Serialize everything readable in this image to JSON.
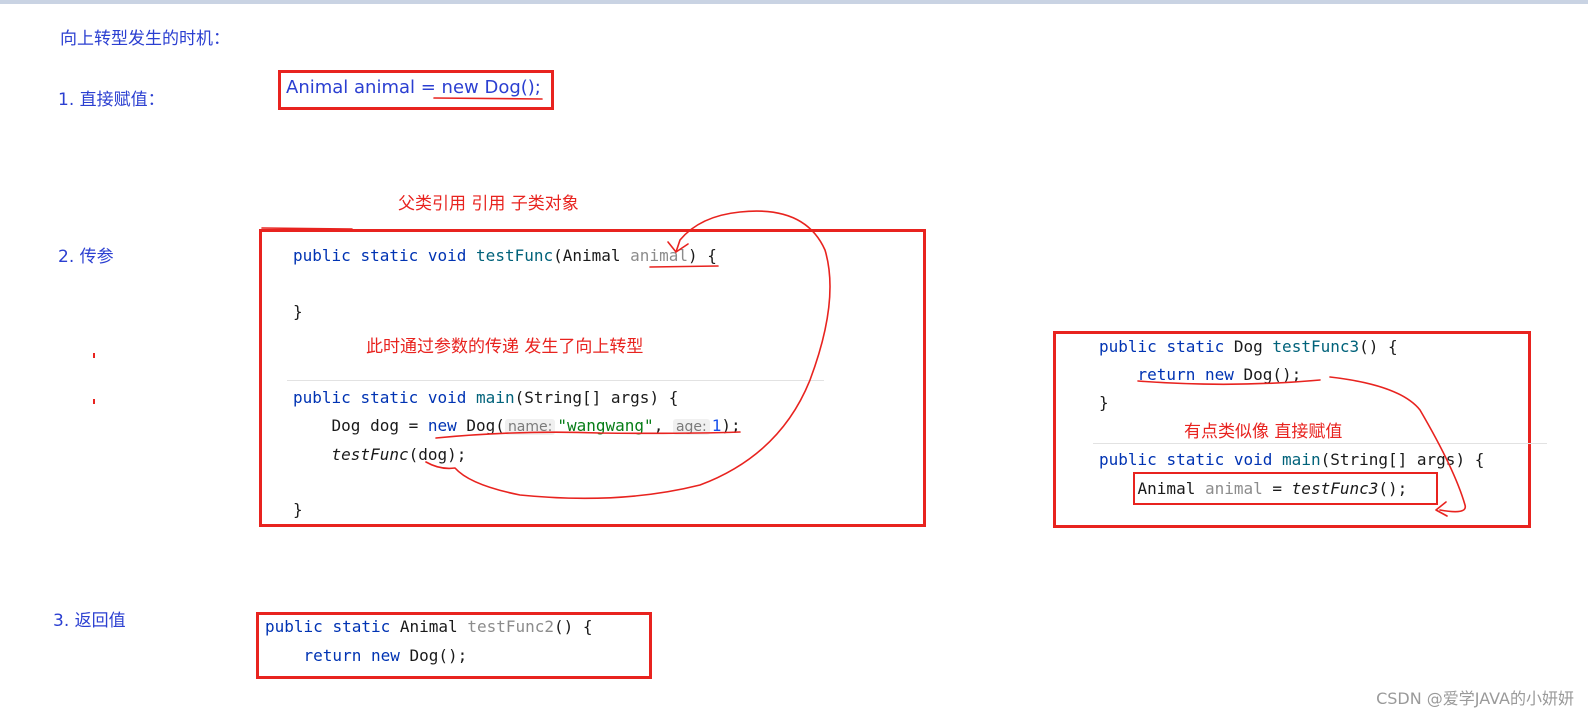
{
  "heading": "向上转型发生的时机：",
  "sections": {
    "s1": {
      "label": "1. 直接赋值：",
      "code": "Animal animal = new Dog();"
    },
    "s2": {
      "label": "2. 传参",
      "annotation_top": "父类引用  引用 子类对象",
      "annotation_mid": "此时通过参数的传递 发生了向上转型",
      "code": {
        "l1_kw1": "public",
        "l1_kw2": "static",
        "l1_kw3": "void",
        "l1_fn": "testFunc",
        "l1_type": "(Animal ",
        "l1_param": "animal",
        "l1_end": ") {",
        "l2": "}",
        "l3_kw1": "public",
        "l3_kw2": "static",
        "l3_kw3": "void",
        "l3_fn": "main",
        "l3_rest": "(String[] args) {",
        "l4_pre": "    Dog dog = ",
        "l4_new": "new",
        "l4_dog": " Dog(",
        "l4_hint1": "name:",
        "l4_str": "\"wangwang\"",
        "l4_comma": ", ",
        "l4_hint2": "age:",
        "l4_num": "1",
        "l4_end": ");",
        "l5_pre": "    ",
        "l5_call": "testFunc",
        "l5_args": "(dog);",
        "l6": "}"
      }
    },
    "s3": {
      "label": "3. 返回值",
      "code": {
        "l1_kw1": "public",
        "l1_kw2": "static",
        "l1_type": "Animal",
        "l1_fn": "testFunc2",
        "l1_end": "() {",
        "l2_pre": "    ",
        "l2_ret": "return",
        "l2_new": "new",
        "l2_rest": " Dog();"
      }
    },
    "s4": {
      "annotation": "有点类似像  直接赋值",
      "code": {
        "l1_kw1": "public",
        "l1_kw2": "static",
        "l1_type": "Dog",
        "l1_fn": "testFunc3",
        "l1_end": "() {",
        "l2_pre": "    ",
        "l2_ret": "return",
        "l2_new": "new",
        "l2_rest": " Dog();",
        "l3": "}",
        "l4_kw1": "public",
        "l4_kw2": "static",
        "l4_kw3": "void",
        "l4_fn": "main",
        "l4_rest": "(String[] args) {",
        "l5_pre": "    ",
        "l5_type": "Animal ",
        "l5_var": "animal",
        "l5_eq": " = ",
        "l5_call": "testFunc3",
        "l5_end": "();"
      }
    }
  },
  "watermark": "CSDN @爱学JAVA的小妍妍",
  "colors": {
    "annotation_red": "#e8231f",
    "note_blue": "#2b3fd1",
    "keyword_blue": "#0033b3"
  }
}
